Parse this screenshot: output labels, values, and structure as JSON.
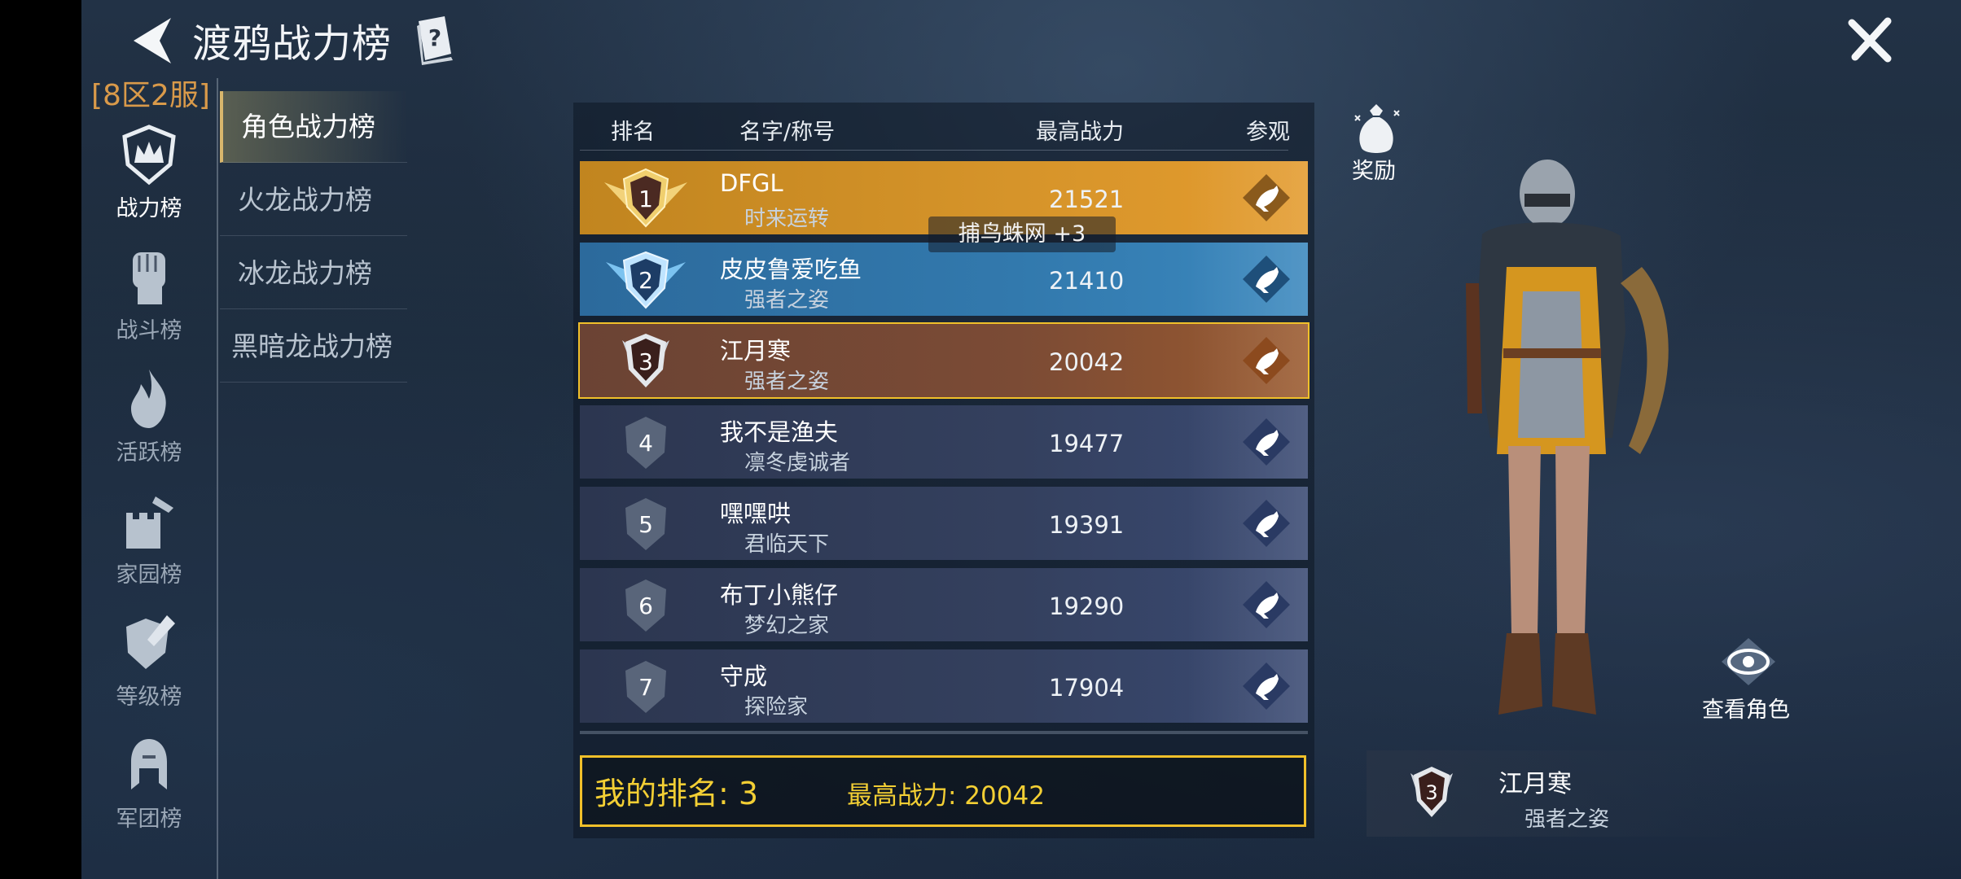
{
  "header": {
    "title": "渡鸦战力榜",
    "back_icon": "back-arrow-icon",
    "help_icon": "help-book-icon",
    "close_icon": "close-x-icon"
  },
  "server": "[8区2服]",
  "nav": [
    {
      "label": "战力榜",
      "icon": "crown-shield-icon",
      "active": true
    },
    {
      "label": "战斗榜",
      "icon": "fist-icon",
      "active": false
    },
    {
      "label": "活跃榜",
      "icon": "flame-icon",
      "active": false
    },
    {
      "label": "家园榜",
      "icon": "castle-icon",
      "active": false
    },
    {
      "label": "等级榜",
      "icon": "shield-sword-icon",
      "active": false
    },
    {
      "label": "军团榜",
      "icon": "helmet-icon",
      "active": false
    }
  ],
  "subtabs": [
    {
      "label": "角色战力榜",
      "active": true
    },
    {
      "label": "火龙战力榜",
      "active": false
    },
    {
      "label": "冰龙战力榜",
      "active": false
    },
    {
      "label": "黑暗龙战力榜",
      "active": false
    }
  ],
  "table": {
    "columns": [
      "排名",
      "名字/称号",
      "最高战力",
      "参观"
    ],
    "rows": [
      {
        "rank": "1",
        "name": "DFGL",
        "title": "时来运转",
        "power": "21521"
      },
      {
        "rank": "2",
        "name": "皮皮鲁爱吃鱼",
        "title": "强者之姿",
        "power": "21410"
      },
      {
        "rank": "3",
        "name": "江月寒",
        "title": "强者之姿",
        "power": "20042"
      },
      {
        "rank": "4",
        "name": "我不是渔夫",
        "title": "凛冬虔诚者",
        "power": "19477"
      },
      {
        "rank": "5",
        "name": "嘿嘿哄",
        "title": "君临天下",
        "power": "19391"
      },
      {
        "rank": "6",
        "name": "布丁小熊仔",
        "title": "梦幻之家",
        "power": "19290"
      },
      {
        "rank": "7",
        "name": "守成",
        "title": "探险家",
        "power": "17904"
      }
    ]
  },
  "tooltip": "捕鸟蛛网 +3",
  "me": {
    "rank_text": "我的排名: 3",
    "power_text": "最高战力: 20042"
  },
  "reward_label": "奖励",
  "view_label": "查看角色",
  "character": {
    "rank": "3",
    "name": "江月寒",
    "title": "强者之姿"
  },
  "colors": {
    "gold": "#f0c02a",
    "rank1": "#d6942a",
    "rank2": "#3279ad",
    "rank3": "#7b4b35",
    "row": "#34405e",
    "server": "#d99a4a"
  }
}
